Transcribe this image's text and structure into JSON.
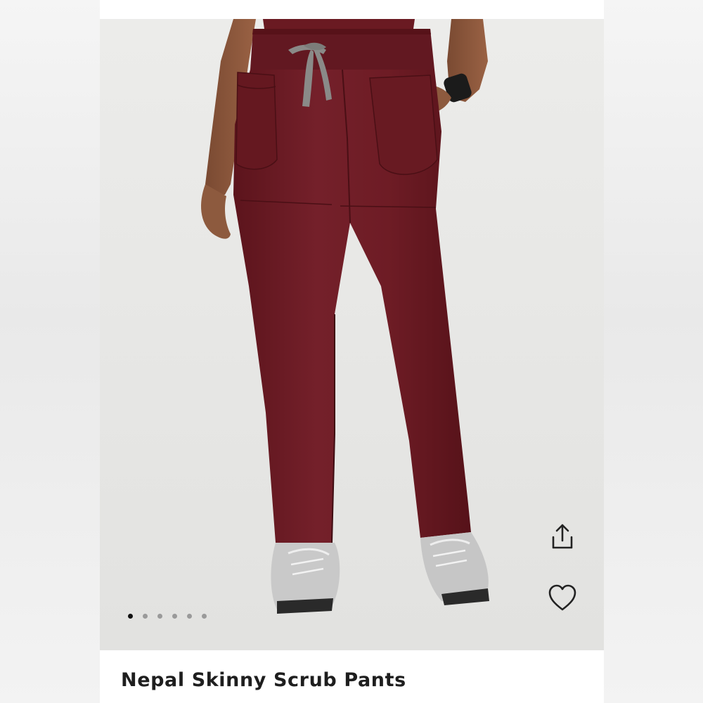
{
  "product": {
    "title": "Nepal Skinny Scrub Pants",
    "image_subject": "Burgundy scrub pants with gray drawstring worn with gray sneakers"
  },
  "gallery": {
    "image_count": 6,
    "active_index": 0
  },
  "actions": {
    "share_icon": "share-icon",
    "favorite_icon": "heart-icon"
  },
  "colors": {
    "pants": "#6e1c25",
    "drawstring": "#8a8a88",
    "active_dot": "#111111",
    "inactive_dot": "#9a9a9a"
  }
}
